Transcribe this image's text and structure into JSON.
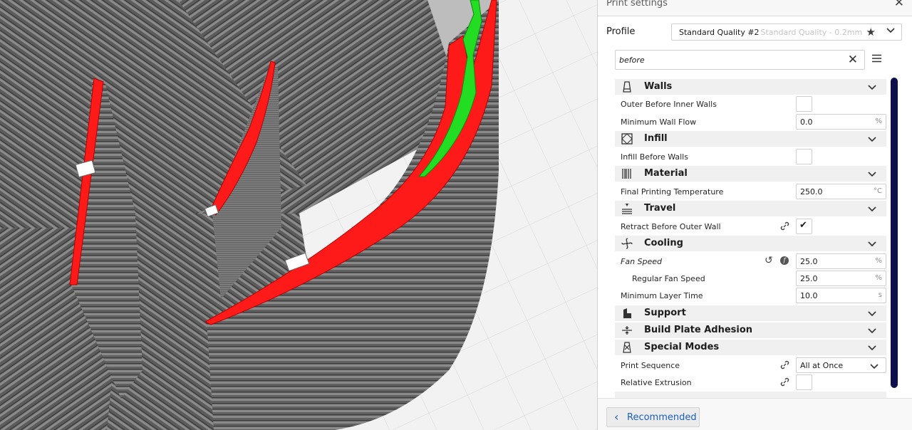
{
  "panel": {
    "title": "Print settings",
    "close_icon": "close-icon",
    "profile_label": "Profile",
    "profile_name": "Standard Quality #2",
    "profile_sub": "- Standard Quality - 0.2mm",
    "search_value": "before"
  },
  "categories": [
    {
      "name": "Walls",
      "icon": "walls-icon"
    },
    {
      "name": "Infill",
      "icon": "infill-icon"
    },
    {
      "name": "Material",
      "icon": "material-icon"
    },
    {
      "name": "Travel",
      "icon": "travel-icon"
    },
    {
      "name": "Cooling",
      "icon": "cooling-icon"
    },
    {
      "name": "Support",
      "icon": "support-icon"
    },
    {
      "name": "Build Plate Adhesion",
      "icon": "build-plate-adhesion-icon"
    },
    {
      "name": "Special Modes",
      "icon": "special-modes-icon"
    }
  ],
  "settings": {
    "outer_before_inner": {
      "label": "Outer Before Inner Walls",
      "checked": false
    },
    "min_wall_flow": {
      "label": "Minimum Wall Flow",
      "value": "0.0",
      "unit": "%"
    },
    "infill_before_walls": {
      "label": "Infill Before Walls",
      "checked": false
    },
    "final_print_temp": {
      "label": "Final Printing Temperature",
      "value": "250.0",
      "unit": "°C"
    },
    "retract_before_outer": {
      "label": "Retract Before Outer Wall",
      "checked": true,
      "checkmark": "✔"
    },
    "fan_speed": {
      "label": "Fan Speed",
      "value": "25.0",
      "unit": "%"
    },
    "regular_fan_speed": {
      "label": "Regular Fan Speed",
      "value": "25.0",
      "unit": "%"
    },
    "min_layer_time": {
      "label": "Minimum Layer Time",
      "value": "10.0",
      "unit": "s"
    },
    "print_sequence": {
      "label": "Print Sequence",
      "value": "All at Once"
    },
    "relative_extrusion": {
      "label": "Relative Extrusion",
      "checked": false
    }
  },
  "footer": {
    "recommended_label": "Recommended"
  },
  "colors": {
    "accent_blue": "#1a5fbf",
    "scrollbar": "#0e0e4b",
    "outer_wall": "#ff1a1a",
    "inner_wall": "#22dd22",
    "model_gray": "#5a5a5a"
  }
}
